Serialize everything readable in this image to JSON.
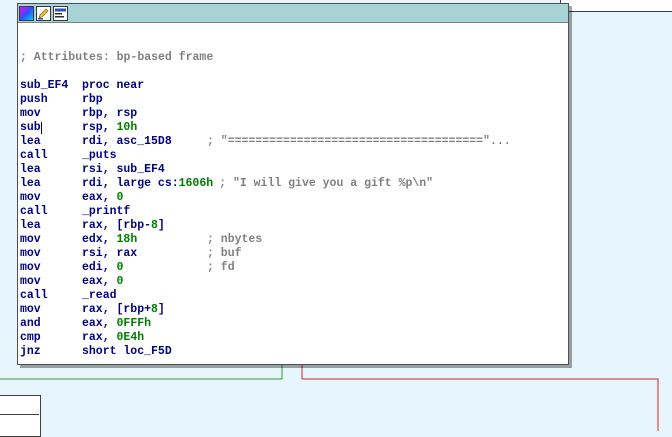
{
  "graph": {
    "colors": {
      "background": "#e6f6fc",
      "green_edge": "#3a9a3a",
      "red_edge": "#e02020",
      "titlebar": "#a6d4d6"
    }
  },
  "node": {
    "toolbar_icons": [
      "color-palette-icon",
      "edit-node-icon",
      "graph-overview-icon"
    ],
    "comment_attributes": "; Attributes: bp-based frame",
    "proc_name": "sub_EF4",
    "proc_keyword": "proc near",
    "instructions": [
      {
        "mn": "push",
        "op": "rbp",
        "cm": ""
      },
      {
        "mn": "mov",
        "op": "rbp, rsp",
        "cm": ""
      },
      {
        "mn": "sub",
        "op": "rsp, ",
        "num": "10h",
        "cm": ""
      },
      {
        "mn": "lea",
        "op": "rdi, asc_15D8",
        "cm": "; \"=====================================\"..."
      },
      {
        "mn": "call",
        "op": "_puts",
        "cm": ""
      },
      {
        "mn": "lea",
        "op": "rsi, sub_EF4",
        "cm": ""
      },
      {
        "mn": "lea",
        "op": "rdi, large cs:",
        "num": "1606h",
        "cm": "; \"I will give you a gift %p\\n\""
      },
      {
        "mn": "mov",
        "op": "eax, ",
        "num": "0",
        "cm": ""
      },
      {
        "mn": "call",
        "op": "_printf",
        "cm": ""
      },
      {
        "mn": "lea",
        "op": "rax, [rbp-",
        "num": "8",
        "tail": "]",
        "cm": ""
      },
      {
        "mn": "mov",
        "op": "edx, ",
        "num": "18h",
        "cm": "; nbytes"
      },
      {
        "mn": "mov",
        "op": "rsi, rax",
        "cm": "; buf"
      },
      {
        "mn": "mov",
        "op": "edi, ",
        "num": "0",
        "cm": "; fd"
      },
      {
        "mn": "mov",
        "op": "eax, ",
        "num": "0",
        "cm": ""
      },
      {
        "mn": "call",
        "op": "_read",
        "cm": ""
      },
      {
        "mn": "mov",
        "op": "rax, [rbp+",
        "num": "8",
        "tail": "]",
        "cm": ""
      },
      {
        "mn": "and",
        "op": "eax, ",
        "num": "0FFFh",
        "cm": ""
      },
      {
        "mn": "cmp",
        "op": "rax, ",
        "num": "0E4h",
        "cm": ""
      },
      {
        "mn": "jnz",
        "op": "short loc_F5D",
        "cm": ""
      }
    ]
  }
}
